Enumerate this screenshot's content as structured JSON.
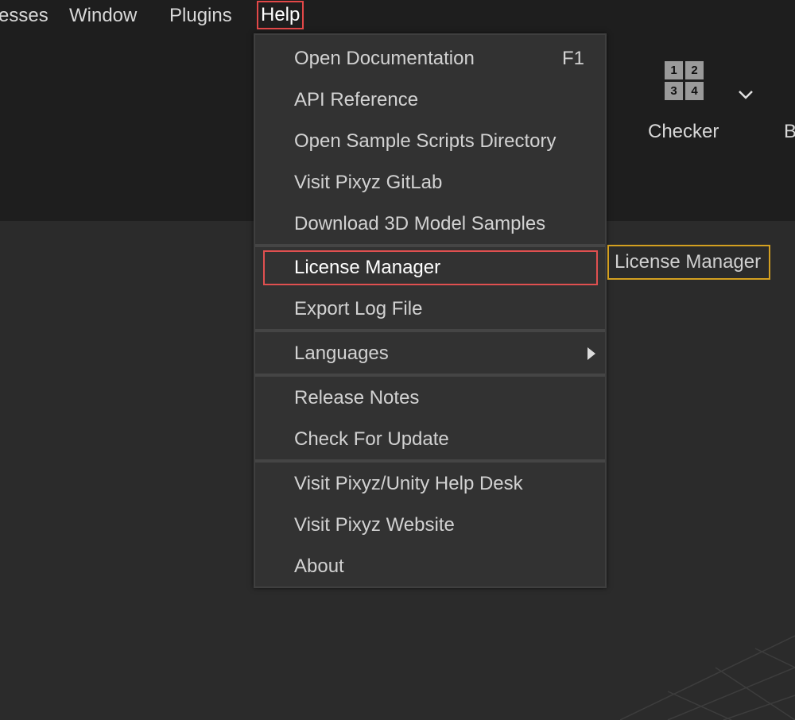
{
  "menubar": {
    "items": [
      {
        "label": "esses"
      },
      {
        "label": "Window"
      },
      {
        "label": "Plugins"
      },
      {
        "label": "Help"
      }
    ]
  },
  "toolbar": {
    "checker": {
      "label": "Checker",
      "icon": "checker-grid-icon",
      "cells": [
        "1",
        "2",
        "3",
        "4"
      ]
    },
    "clipped_label": "B"
  },
  "help_menu": {
    "items": [
      {
        "label": "Open Documentation",
        "shortcut": "F1"
      },
      {
        "label": "API Reference"
      },
      {
        "label": "Open Sample Scripts Directory"
      },
      {
        "label": "Visit Pixyz GitLab"
      },
      {
        "label": "Download 3D Model Samples"
      },
      {
        "label": "License Manager"
      },
      {
        "label": "Export Log File"
      },
      {
        "label": "Languages",
        "submenu": true
      },
      {
        "label": "Release Notes"
      },
      {
        "label": "Check For Update"
      },
      {
        "label": "Visit Pixyz/Unity Help Desk"
      },
      {
        "label": "Visit Pixyz Website"
      },
      {
        "label": "About"
      }
    ]
  },
  "tooltip": {
    "text": "License Manager"
  },
  "colors": {
    "highlight_border": "#e05050",
    "tooltip_border": "#d4a020",
    "menu_bg": "#323232",
    "toolbar_bg": "#1e1e1e"
  }
}
